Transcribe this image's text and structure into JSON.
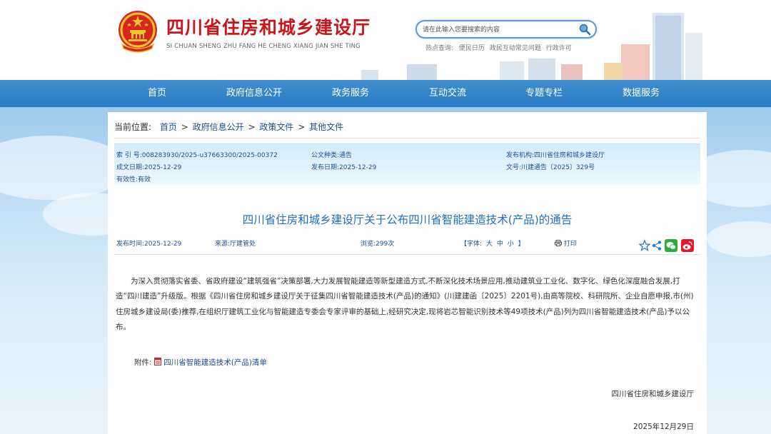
{
  "header": {
    "site_title": "四川省住房和城乡建设厅",
    "site_pinyin": "SI CHUAN SHENG ZHU FANG HE CHENG XIANG JIAN SHE TING",
    "search_placeholder": "请在此输入您要搜索的内容",
    "hot_label": "热点查询:",
    "hot_links": [
      "便民日历",
      "政民互动常见问题",
      "行政许可"
    ],
    "brand_red": "#c8161d"
  },
  "nav": {
    "items": [
      "首页",
      "政府信息公开",
      "政务服务",
      "互动交流",
      "专题专栏",
      "数据服务"
    ],
    "color": "#2a7bc3"
  },
  "breadcrumb": {
    "label": "当前位置:",
    "items": [
      "首页",
      "政府信息公开",
      "政策文件",
      "其他文件"
    ],
    "sep": ">"
  },
  "meta": {
    "index_no": "索 引 号:008283930/2025-u37663300/2025-00372",
    "doc_type": "公文种类:通告",
    "publisher": "发布机构:四川省住房和城乡建设厅",
    "written_date": "成文日期:2025-12-29",
    "publish_date": "发布日期:2025-12-29",
    "doc_no": "文号:川建通告〔2025〕329号",
    "validity": "有效性:有效"
  },
  "article": {
    "title": "四川省住房和城乡建设厅关于公布四川省智能建造技术(产品)的通告",
    "publish_time": "发布时间:2025-12-29",
    "source": "来源:厅建管处",
    "views": "浏览:299次",
    "font_label": "【字体:",
    "font_large": "大",
    "font_medium": "中",
    "font_small": "小",
    "font_close": "】",
    "print_label": "打印",
    "body": "为深入贯彻落实省委、省政府建设“建筑强省”决策部署,大力发展智能建造等新型建造方式,不断深化技术场景应用,推动建筑业工业化、数字化、绿色化深度融合发展,打造“四川建造”升级版。根据《四川省住房和城乡建设厅关于征集四川省智能建造技术(产品)的通知》(川建建函〔2025〕2201号),由高等院校、科研院所、企业自愿申报,市(州)住房城乡建设局(委)推荐,在组织厅建筑工业化与智能建造专委会专家评审的基础上,经研究决定,现将岩芯智能识别技术等49项技术(产品)列为四川省智能建造技术(产品)予以公布。",
    "attachment_label": "附件:",
    "attachment_name": "四川省智能建造技术(产品)清单",
    "signer": "四川省住房和城乡建设厅",
    "sign_date": "2025年12月29日"
  }
}
